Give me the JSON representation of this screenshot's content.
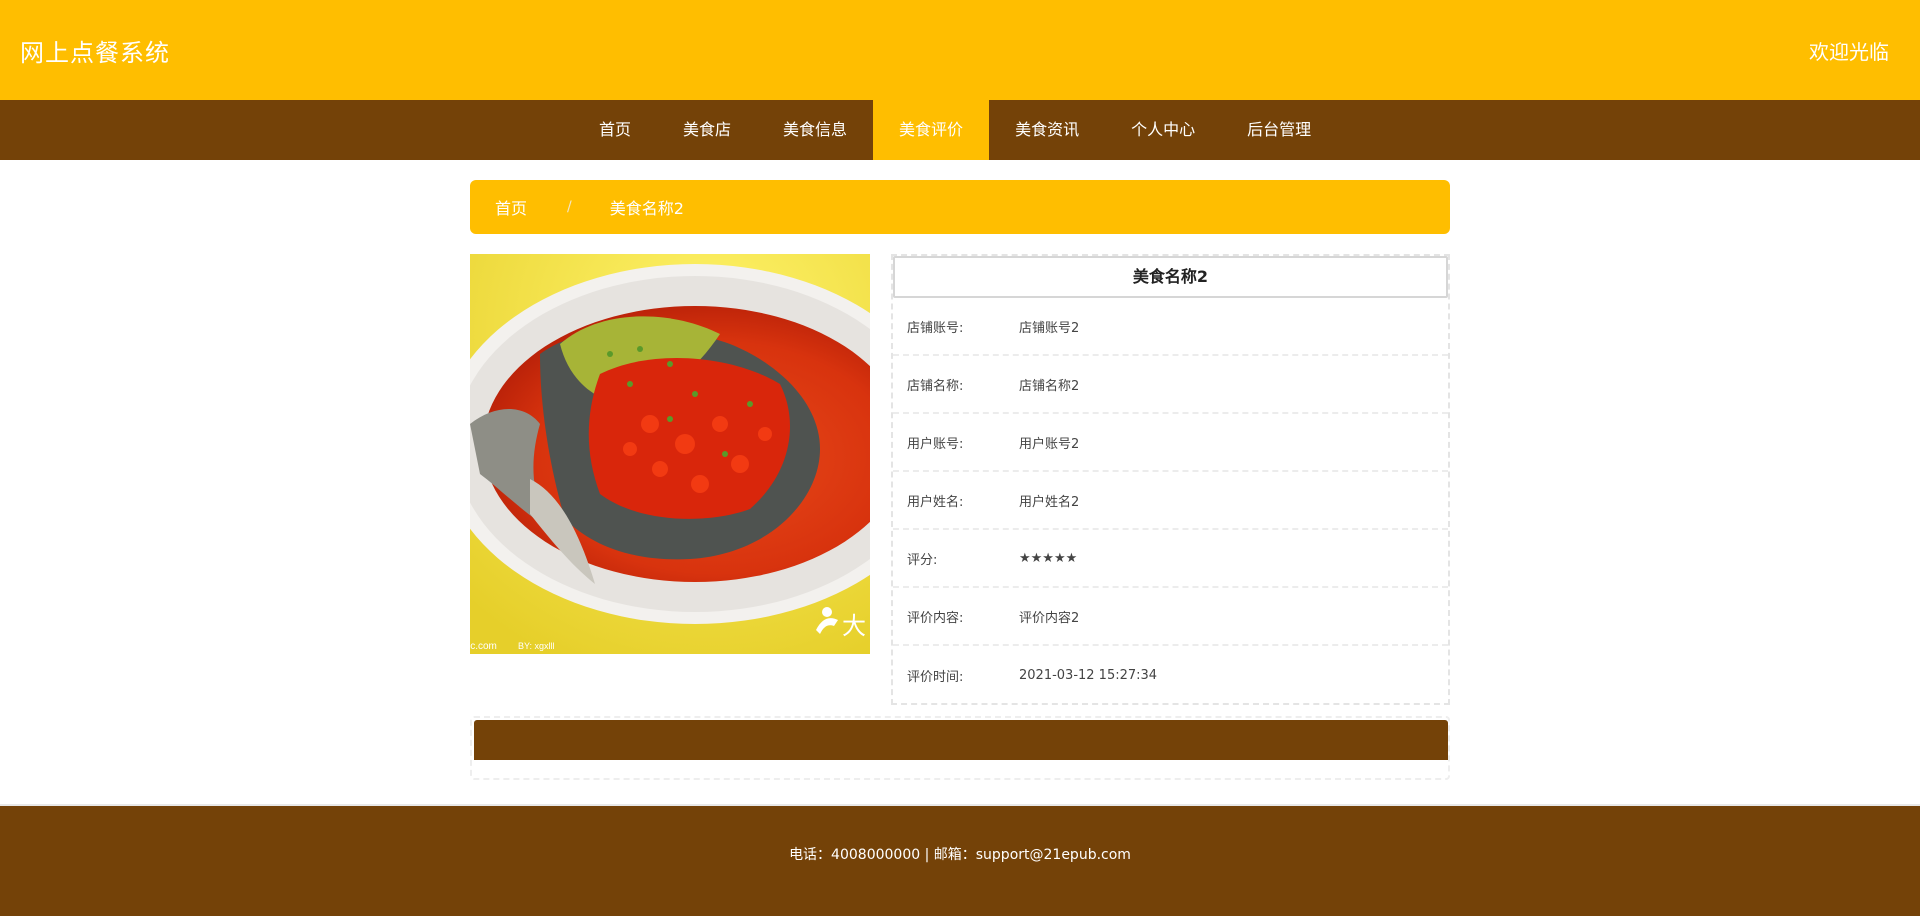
{
  "header": {
    "site_title": "网上点餐系统",
    "welcome": "欢迎光临"
  },
  "nav": {
    "items": [
      {
        "label": "首页"
      },
      {
        "label": "美食店"
      },
      {
        "label": "美食信息"
      },
      {
        "label": "美食评价"
      },
      {
        "label": "美食资讯"
      },
      {
        "label": "个人中心"
      },
      {
        "label": "后台管理"
      }
    ],
    "active_item": "美食评价"
  },
  "breadcrumb": {
    "home": "首页",
    "separator": "/",
    "current": "美食名称2"
  },
  "food_image": {
    "alt": "美食图片",
    "watermark_left": "ic.com",
    "watermark_by": "BY: xgxlll",
    "watermark_right": "大"
  },
  "detail": {
    "title": "美食名称2",
    "rows": [
      {
        "label": "店铺账号:",
        "value": "店铺账号2"
      },
      {
        "label": "店铺名称:",
        "value": "店铺名称2"
      },
      {
        "label": "用户账号:",
        "value": "用户账号2"
      },
      {
        "label": "用户姓名:",
        "value": "用户姓名2"
      },
      {
        "label": "评分:",
        "value": "★★★★★"
      },
      {
        "label": "评价内容:",
        "value": "评价内容2"
      },
      {
        "label": "评价时间:",
        "value": "2021-03-12 15:27:34"
      }
    ]
  },
  "footer": {
    "contact": "电话：4008000000 | 邮箱：support@21epub.com"
  },
  "colors": {
    "primary_yellow": "#ffbe00",
    "dark_brown": "#744208",
    "white": "#ffffff"
  }
}
